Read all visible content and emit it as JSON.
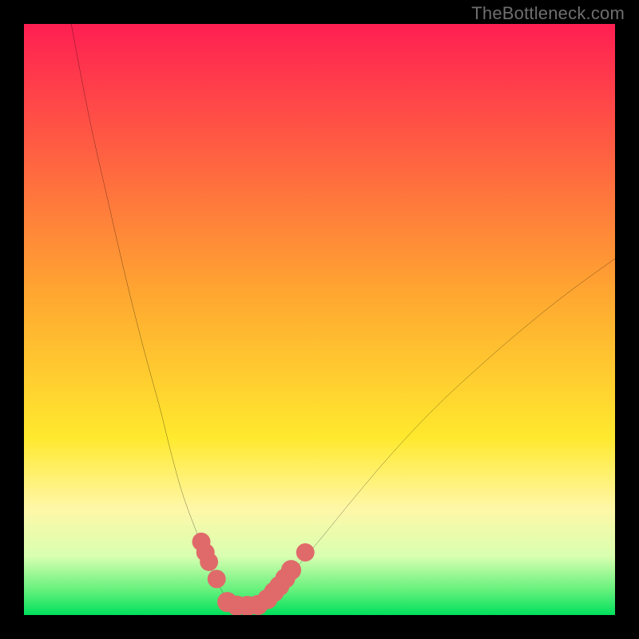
{
  "watermark": "TheBottleneck.com",
  "chart_data": {
    "type": "line",
    "title": "",
    "xlabel": "",
    "ylabel": "",
    "xlim": [
      0,
      100
    ],
    "ylim": [
      0,
      100
    ],
    "background_gradient_stops": [
      {
        "offset": 0.0,
        "color": "#ff1f52"
      },
      {
        "offset": 0.45,
        "color": "#ffa531"
      },
      {
        "offset": 0.7,
        "color": "#ffe92e"
      },
      {
        "offset": 0.82,
        "color": "#fff7a8"
      },
      {
        "offset": 0.9,
        "color": "#d9ffb0"
      },
      {
        "offset": 0.96,
        "color": "#60f07a"
      },
      {
        "offset": 1.0,
        "color": "#00e05c"
      }
    ],
    "series": [
      {
        "name": "left-branch",
        "x": [
          8,
          9.5,
          11.5,
          14,
          17,
          20,
          23,
          25,
          27,
          29.8,
          32,
          33.7,
          34.5,
          35
        ],
        "values": [
          100,
          92,
          82,
          71,
          58,
          46,
          35,
          27,
          20,
          12.5,
          7,
          3.7,
          2.2,
          1.6
        ]
      },
      {
        "name": "right-branch",
        "x": [
          40,
          41.3,
          43.4,
          46.5,
          50.7,
          56,
          62.5,
          69.5,
          77,
          84.5,
          92,
          100
        ],
        "values": [
          1.7,
          2.8,
          5,
          8.5,
          13.5,
          20,
          27.6,
          35,
          42,
          48.5,
          54.5,
          60.3
        ]
      }
    ],
    "markers": [
      {
        "x": 30.0,
        "y": 12.4,
        "r": 1.55
      },
      {
        "x": 30.7,
        "y": 10.6,
        "r": 1.55
      },
      {
        "x": 31.3,
        "y": 9.0,
        "r": 1.55
      },
      {
        "x": 32.6,
        "y": 6.1,
        "r": 1.55
      },
      {
        "x": 34.4,
        "y": 2.2,
        "r": 1.7
      },
      {
        "x": 36.0,
        "y": 1.6,
        "r": 1.7
      },
      {
        "x": 37.8,
        "y": 1.55,
        "r": 1.7
      },
      {
        "x": 39.6,
        "y": 1.7,
        "r": 1.7
      },
      {
        "x": 41.2,
        "y": 2.7,
        "r": 1.7
      },
      {
        "x": 42.3,
        "y": 3.9,
        "r": 1.7
      },
      {
        "x": 43.2,
        "y": 4.9,
        "r": 1.7
      },
      {
        "x": 44.2,
        "y": 6.2,
        "r": 1.7
      },
      {
        "x": 45.2,
        "y": 7.6,
        "r": 1.7
      },
      {
        "x": 47.6,
        "y": 10.6,
        "r": 1.55
      }
    ],
    "marker_color": "#e06a6a",
    "curve_color": "#000000",
    "curve_width": 2.0
  }
}
